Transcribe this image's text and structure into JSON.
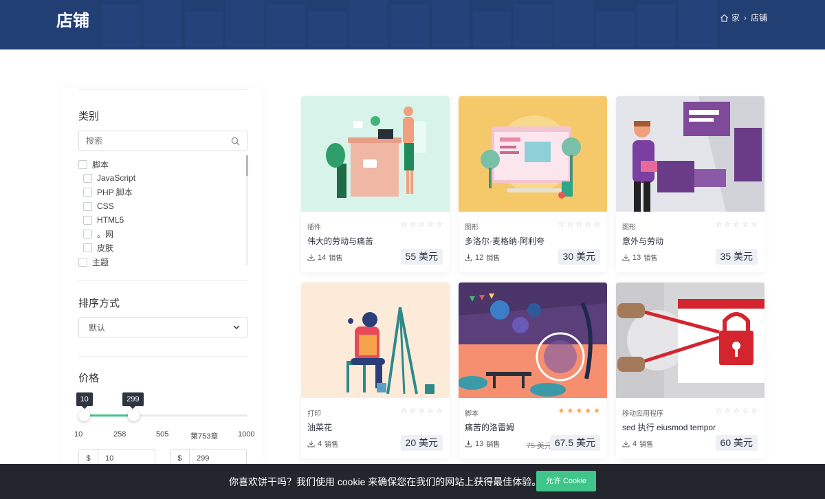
{
  "header": {
    "title": "店铺",
    "breadcrumb": {
      "home": "家",
      "current": "店铺"
    }
  },
  "sidebar": {
    "category_title": "类别",
    "search_placeholder": "搜索",
    "categories": [
      {
        "label": "脚本",
        "sub": false
      },
      {
        "label": "JavaScript",
        "sub": true
      },
      {
        "label": "PHP 脚本",
        "sub": true
      },
      {
        "label": "CSS",
        "sub": true
      },
      {
        "label": "HTML5",
        "sub": true
      },
      {
        "label": "。网",
        "sub": true
      },
      {
        "label": "皮肤",
        "sub": true
      },
      {
        "label": "主题",
        "sub": false
      }
    ],
    "sort_title": "排序方式",
    "sort_value": "默认",
    "price_title": "价格",
    "price_range": {
      "min": 10,
      "max": 1000,
      "from": 10,
      "to": 299
    },
    "tooltip_from": "10",
    "tooltip_to": "299",
    "ticks": [
      "10",
      "258",
      "505",
      "第753章",
      "1000"
    ],
    "currency": "$",
    "input_from": "10",
    "input_to": "299"
  },
  "products": [
    {
      "category": "插件",
      "name": "伟大的劳动与痛苦",
      "sales": "14",
      "sales_label": "销售",
      "price": "55 美元",
      "old_price": "",
      "rating": 0,
      "bg": "#d7f3ea"
    },
    {
      "category": "图形",
      "name": "多洛尔·麦格纳·阿利夸",
      "sales": "12",
      "sales_label": "销售",
      "price": "30 美元",
      "old_price": "",
      "rating": 0,
      "bg": "#f5c96a"
    },
    {
      "category": "图形",
      "name": "意外与劳动",
      "sales": "13",
      "sales_label": "销售",
      "price": "35 美元",
      "old_price": "",
      "rating": 0,
      "bg": "#e3e5ea"
    },
    {
      "category": "打印",
      "name": "油菜花",
      "sales": "4",
      "sales_label": "销售",
      "price": "20 美元",
      "old_price": "",
      "rating": 0,
      "bg": "#fdebd9"
    },
    {
      "category": "脚本",
      "name": "痛苦的洛雷姆",
      "sales": "13",
      "sales_label": "销售",
      "price": "67.5 美元",
      "old_price": "75 美元",
      "rating": 5,
      "bg": "#f58f6f"
    },
    {
      "category": "移动应用程序",
      "name": "sed 执行 eiusmod tempor",
      "sales": "4",
      "sales_label": "销售",
      "price": "60 美元",
      "old_price": "",
      "rating": 0,
      "bg": "#d6d6d8"
    }
  ],
  "cookie": {
    "message": "你喜欢饼干吗？我们使用 cookie 来确保您在我们的网站上获得最佳体验。",
    "button": "允许 Cookie"
  },
  "colors": {
    "header": "#223f74",
    "accent": "#3fc58a",
    "star_on": "#f5a34a"
  },
  "icons": [
    "home-icon",
    "chevron-right-icon",
    "search-icon",
    "chevron-down-icon",
    "star-icon",
    "download-icon"
  ]
}
